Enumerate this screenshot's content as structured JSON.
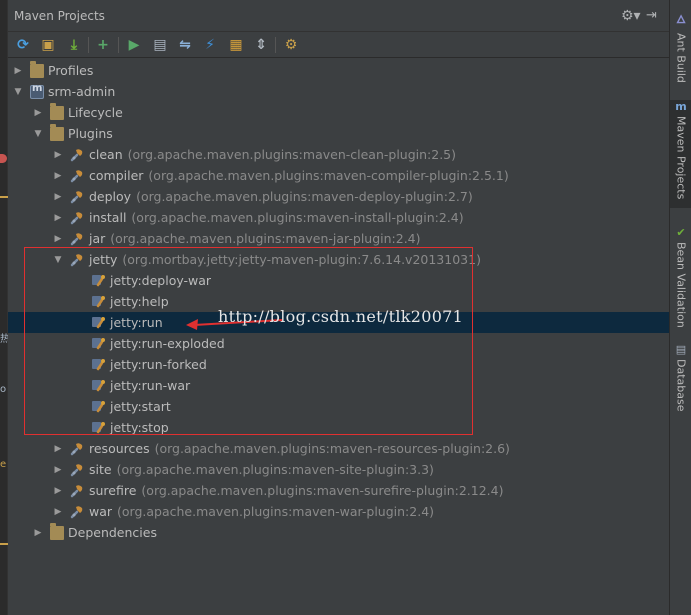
{
  "panel": {
    "title": "Maven Projects"
  },
  "tree": {
    "rows": [
      {
        "label": "Profiles",
        "dim": "",
        "depth": 0,
        "arrow": "right",
        "icon": "folder"
      },
      {
        "label": "srm-admin",
        "dim": "",
        "depth": 0,
        "arrow": "down",
        "icon": "maven"
      },
      {
        "label": "Lifecycle",
        "dim": "",
        "depth": 1,
        "arrow": "right",
        "icon": "folder"
      },
      {
        "label": "Plugins",
        "dim": "",
        "depth": 1,
        "arrow": "down",
        "icon": "folder"
      },
      {
        "label": "clean",
        "dim": "(org.apache.maven.plugins:maven-clean-plugin:2.5)",
        "depth": 2,
        "arrow": "right",
        "icon": "plugin"
      },
      {
        "label": "compiler",
        "dim": "(org.apache.maven.plugins:maven-compiler-plugin:2.5.1)",
        "depth": 2,
        "arrow": "right",
        "icon": "plugin"
      },
      {
        "label": "deploy",
        "dim": "(org.apache.maven.plugins:maven-deploy-plugin:2.7)",
        "depth": 2,
        "arrow": "right",
        "icon": "plugin"
      },
      {
        "label": "install",
        "dim": "(org.apache.maven.plugins:maven-install-plugin:2.4)",
        "depth": 2,
        "arrow": "right",
        "icon": "plugin"
      },
      {
        "label": "jar",
        "dim": "(org.apache.maven.plugins:maven-jar-plugin:2.4)",
        "depth": 2,
        "arrow": "right",
        "icon": "plugin"
      },
      {
        "label": "jetty",
        "dim": "(org.mortbay.jetty:jetty-maven-plugin:7.6.14.v20131031)",
        "depth": 2,
        "arrow": "down",
        "icon": "plugin"
      },
      {
        "label": "jetty:deploy-war",
        "dim": "",
        "depth": 3,
        "arrow": "",
        "icon": "goal"
      },
      {
        "label": "jetty:help",
        "dim": "",
        "depth": 3,
        "arrow": "",
        "icon": "goal"
      },
      {
        "label": "jetty:run",
        "dim": "",
        "depth": 3,
        "arrow": "",
        "icon": "goal",
        "selected": true
      },
      {
        "label": "jetty:run-exploded",
        "dim": "",
        "depth": 3,
        "arrow": "",
        "icon": "goal"
      },
      {
        "label": "jetty:run-forked",
        "dim": "",
        "depth": 3,
        "arrow": "",
        "icon": "goal"
      },
      {
        "label": "jetty:run-war",
        "dim": "",
        "depth": 3,
        "arrow": "",
        "icon": "goal"
      },
      {
        "label": "jetty:start",
        "dim": "",
        "depth": 3,
        "arrow": "",
        "icon": "goal"
      },
      {
        "label": "jetty:stop",
        "dim": "",
        "depth": 3,
        "arrow": "",
        "icon": "goal"
      },
      {
        "label": "resources",
        "dim": "(org.apache.maven.plugins:maven-resources-plugin:2.6)",
        "depth": 2,
        "arrow": "right",
        "icon": "plugin"
      },
      {
        "label": "site",
        "dim": "(org.apache.maven.plugins:maven-site-plugin:3.3)",
        "depth": 2,
        "arrow": "right",
        "icon": "plugin"
      },
      {
        "label": "surefire",
        "dim": "(org.apache.maven.plugins:maven-surefire-plugin:2.12.4)",
        "depth": 2,
        "arrow": "right",
        "icon": "plugin"
      },
      {
        "label": "war",
        "dim": "(org.apache.maven.plugins:maven-war-plugin:2.4)",
        "depth": 2,
        "arrow": "right",
        "icon": "plugin"
      },
      {
        "label": "Dependencies",
        "dim": "",
        "depth": 1,
        "arrow": "right",
        "icon": "folder"
      }
    ]
  },
  "toolbar": {
    "buttons": [
      {
        "name": "reimport-icon",
        "glyph": "⟳",
        "color": "#4a9fe0"
      },
      {
        "name": "generate-sources-icon",
        "glyph": "▣",
        "color": "#c9a04a"
      },
      {
        "name": "download-icon",
        "glyph": "⤓",
        "color": "#6fb03a"
      },
      {
        "name": "add-icon",
        "glyph": "+",
        "color": "#59a869"
      },
      {
        "name": "run-icon",
        "glyph": "▶",
        "color": "#59a869"
      },
      {
        "name": "run-config-icon",
        "glyph": "▤",
        "color": "#aab4c0"
      },
      {
        "name": "toggle-offline-icon",
        "glyph": "⇋",
        "color": "#8ab0d8"
      },
      {
        "name": "skip-tests-icon",
        "glyph": "⚡",
        "color": "#3f8fd6"
      },
      {
        "name": "show-dependencies-icon",
        "glyph": "▦",
        "color": "#d8a23a"
      },
      {
        "name": "collapse-all-icon",
        "glyph": "⇕",
        "color": "#b0b8c0"
      },
      {
        "name": "settings-icon",
        "glyph": "⚙",
        "color": "#c9a04a"
      }
    ]
  },
  "right_bar": {
    "tabs": [
      {
        "label": "Ant Build",
        "icon": "ant-icon"
      },
      {
        "label": "Maven Projects",
        "icon": "maven-icon"
      },
      {
        "label": "Bean Validation",
        "icon": "bean-icon"
      },
      {
        "label": "Database",
        "icon": "database-icon"
      }
    ]
  },
  "annotation": {
    "watermark": "http://blog.csdn.net/tlk20071"
  },
  "left_strip": {
    "chars": [
      "热",
      "o",
      "e"
    ]
  },
  "colors": {
    "selection": "#0d293e",
    "highlight_box": "#e03030",
    "background": "#3c3f41"
  }
}
